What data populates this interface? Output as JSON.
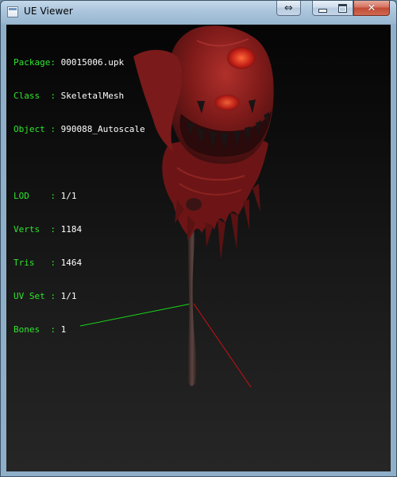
{
  "window": {
    "title": "UE Viewer",
    "buttons": {
      "resize_glyph": "⇔",
      "close_glyph": "✕"
    }
  },
  "viewer": {
    "package": {
      "label": "Package:",
      "value": "00015006.upk"
    },
    "class": {
      "label": "Class  :",
      "value": "SkeletalMesh"
    },
    "object": {
      "label": "Object :",
      "value": "990088_Autoscale"
    },
    "lod": {
      "label": "LOD    :",
      "value": "1/1"
    },
    "verts": {
      "label": "Verts  :",
      "value": "1184"
    },
    "tris": {
      "label": "Tris   :",
      "value": "1464"
    },
    "uvset": {
      "label": "UV Set :",
      "value": "1/1"
    },
    "bones": {
      "label": "Bones  :",
      "value": "1"
    }
  },
  "colors": {
    "label_green": "#2ee52e",
    "value_white": "#ffffff",
    "axis_x": "#cc1111",
    "axis_y": "#19d619",
    "mesh_red": "#8a1b1b",
    "mesh_dark": "#3a1010",
    "handle": "#4a3430"
  },
  "icons": {
    "app": "app-window-icon",
    "resize": "resize-arrows-icon",
    "minimize": "minimize-icon",
    "maximize": "maximize-icon",
    "close": "close-icon"
  }
}
